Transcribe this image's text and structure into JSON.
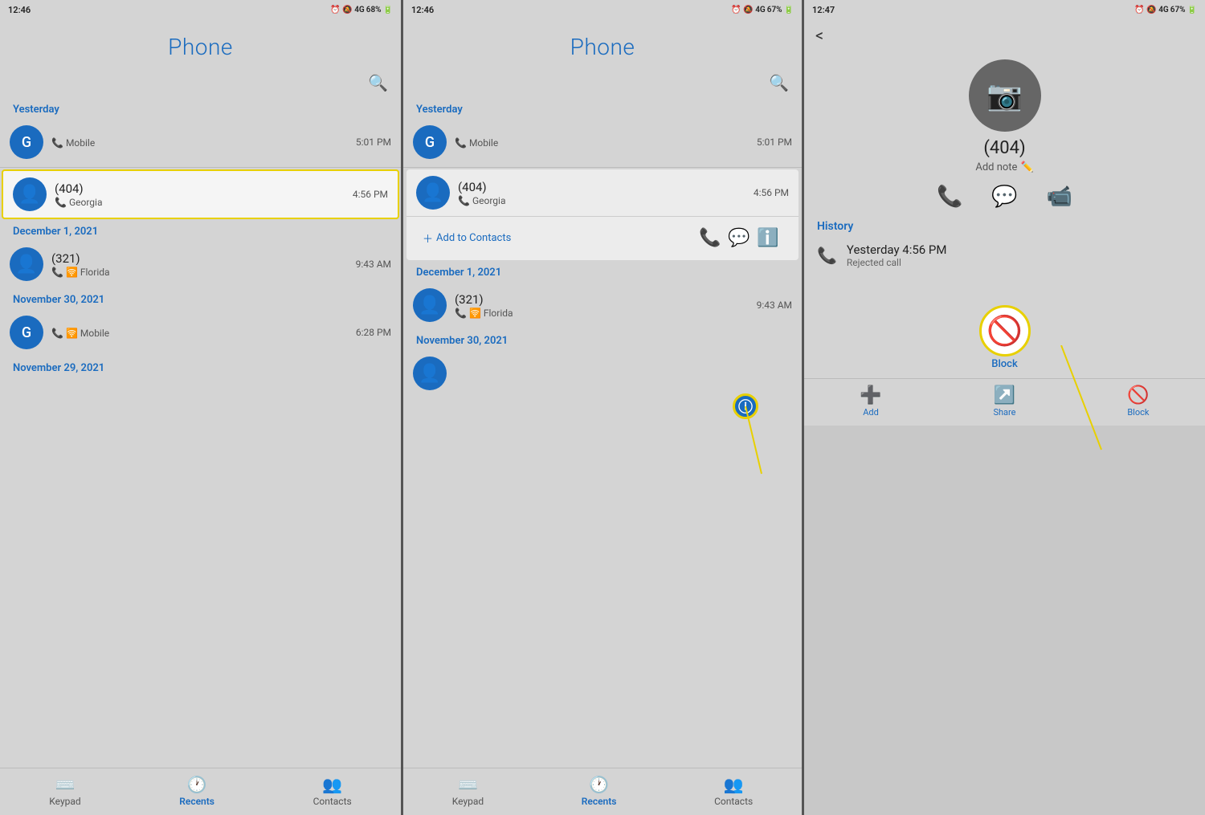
{
  "panels": {
    "panel1": {
      "statusBar": {
        "time": "12:46",
        "battery": "68%",
        "signal": "4G"
      },
      "title": "Phone",
      "sections": [
        {
          "label": "Yesterday",
          "items": [
            {
              "avatar": "G",
              "avatarType": "letter",
              "name": "",
              "sub": "Mobile",
              "time": "5:01 PM",
              "highlighted": false
            },
            {
              "avatar": "person",
              "avatarType": "icon",
              "name": "(404)",
              "sub": "Georgia",
              "time": "4:56 PM",
              "highlighted": true
            }
          ]
        },
        {
          "label": "December 1, 2021",
          "items": [
            {
              "avatar": "person",
              "avatarType": "icon",
              "name": "(321)",
              "sub": "Florida",
              "time": "9:43 AM",
              "highlighted": false
            }
          ]
        },
        {
          "label": "November 30, 2021",
          "items": [
            {
              "avatar": "G",
              "avatarType": "letter",
              "name": "",
              "sub": "Mobile",
              "time": "6:28 PM",
              "highlighted": false
            }
          ]
        },
        {
          "label": "November 29, 2021",
          "items": []
        }
      ],
      "nav": [
        {
          "label": "Keypad",
          "active": false
        },
        {
          "label": "Recents",
          "active": true
        },
        {
          "label": "Contacts",
          "active": false
        }
      ]
    },
    "panel2": {
      "statusBar": {
        "time": "12:46",
        "battery": "67%",
        "signal": "4G"
      },
      "title": "Phone",
      "sections": [
        {
          "label": "Yesterday",
          "items": [
            {
              "avatar": "G",
              "avatarType": "letter",
              "name": "",
              "sub": "Mobile",
              "time": "5:01 PM",
              "expanded": false
            },
            {
              "avatar": "person",
              "avatarType": "icon",
              "name": "(404)",
              "sub": "Georgia",
              "time": "4:56 PM",
              "expanded": true,
              "addContact": "+ Add to Contacts",
              "actions": [
                "call",
                "message",
                "info"
              ]
            }
          ]
        },
        {
          "label": "December 1, 2021",
          "items": [
            {
              "avatar": "person",
              "avatarType": "icon",
              "name": "(321)",
              "sub": "Florida",
              "time": "9:43 AM",
              "expanded": false
            }
          ]
        },
        {
          "label": "November 30, 2021",
          "items": []
        }
      ],
      "nav": [
        {
          "label": "Keypad",
          "active": false
        },
        {
          "label": "Recents",
          "active": true
        },
        {
          "label": "Contacts",
          "active": false
        }
      ],
      "infoBubble": {
        "label": "i"
      }
    },
    "panel3": {
      "statusBar": {
        "time": "12:47",
        "battery": "67%",
        "signal": "4G"
      },
      "backLabel": "<",
      "contactNumber": "(404)",
      "addNoteLabel": "Add note",
      "actions": [
        "call",
        "message",
        "video"
      ],
      "historyLabel": "History",
      "historyItems": [
        {
          "time": "Yesterday 4:56 PM",
          "desc": "Rejected call"
        }
      ],
      "blockLabel": "Block",
      "bottomNav": [
        {
          "label": "Add",
          "icon": "+"
        },
        {
          "label": "Share",
          "icon": "share"
        },
        {
          "label": "Block",
          "icon": "block"
        }
      ]
    }
  }
}
